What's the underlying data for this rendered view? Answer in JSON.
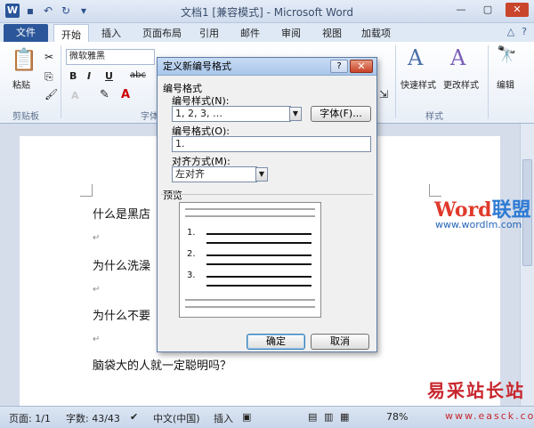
{
  "window": {
    "title": "文档1 [兼容模式] - Microsoft Word",
    "logo_letter": "W"
  },
  "tabs": {
    "file": "文件",
    "items": [
      "开始",
      "插入",
      "页面布局",
      "引用",
      "邮件",
      "审阅",
      "视图",
      "加载项"
    ]
  },
  "ribbon": {
    "paste_label": "粘贴",
    "clipboard_label": "剪贴板",
    "font_name": "微软雅黑",
    "font_group_label": "字体",
    "styles_quick_label": "快速样式",
    "styles_change_label": "更改样式",
    "styles_group_label": "样式",
    "edit_label": "编辑",
    "bold": "B",
    "italic": "I",
    "underline": "U",
    "strike": "abc",
    "font_color": "A"
  },
  "document": {
    "lines": [
      "什么是黑店",
      "为什么洗澡",
      "为什么不要",
      "脑袋大的人就一定聪明吗？"
    ],
    "para_mark": "↵"
  },
  "watermark": {
    "brand_a": "Word",
    "brand_b": "联盟",
    "url": "www.wordlm.com",
    "site_name": "易采站长站",
    "site_url": "www.easck.com"
  },
  "statusbar": {
    "page": "页面: 1/1",
    "words": "字数: 43/43",
    "language": "中文(中国)",
    "mode": "插入",
    "zoom": "78%"
  },
  "dialog": {
    "title": "定义新编号格式",
    "help": "?",
    "close": "✕",
    "group_label": "编号格式",
    "style_label": "编号样式(N):",
    "style_value": "1, 2, 3, …",
    "font_button": "字体(F)...",
    "format_label": "编号格式(O):",
    "format_value": "1.",
    "align_label": "对齐方式(M):",
    "align_value": "左对齐",
    "preview_label": "预览",
    "preview_numbers": [
      "1.",
      "2.",
      "3."
    ],
    "ok": "确定",
    "cancel": "取消"
  }
}
